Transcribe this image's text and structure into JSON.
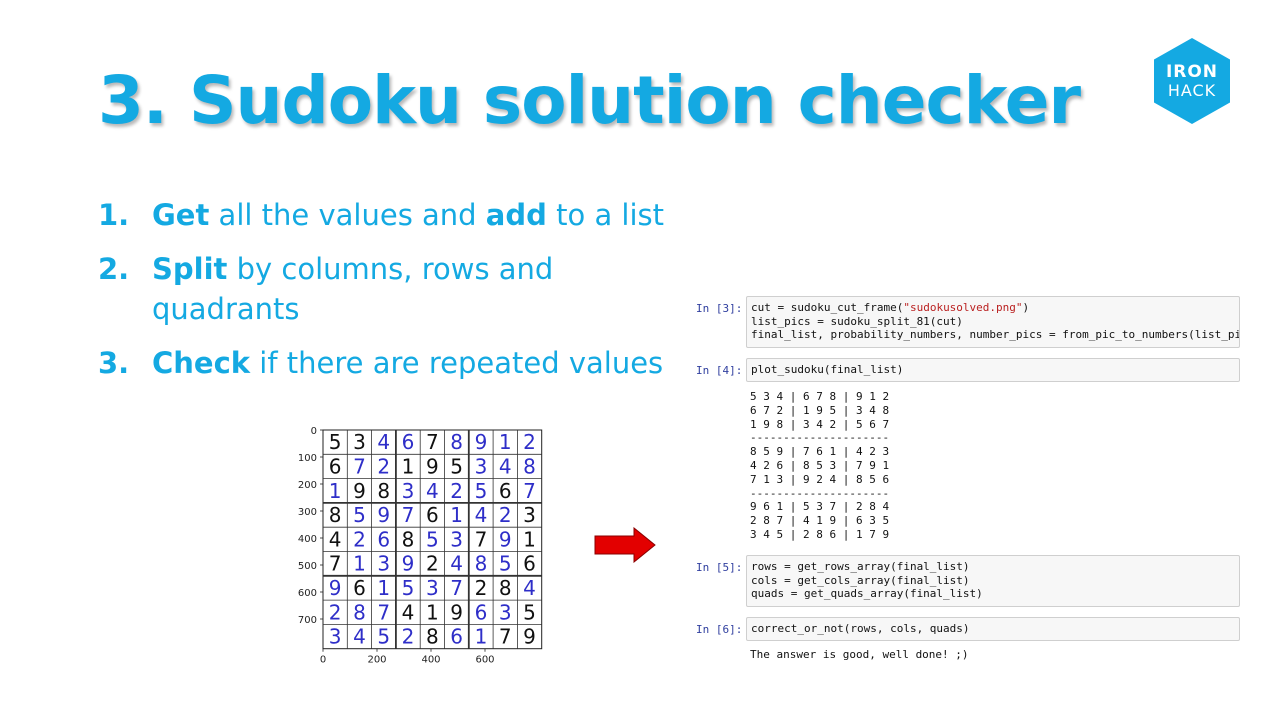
{
  "title": "3. Sudoku solution checker",
  "logo": {
    "line1": "IRON",
    "line2": "HACK",
    "color": "#14a9e2"
  },
  "steps": [
    {
      "num": "1.",
      "parts": [
        {
          "t": "Get",
          "b": true
        },
        {
          "t": " all the values and ",
          "b": false
        },
        {
          "t": "add",
          "b": true
        },
        {
          "t": " to a list",
          "b": false
        }
      ]
    },
    {
      "num": "2.",
      "parts": [
        {
          "t": "Split",
          "b": true
        },
        {
          "t": " by columns, rows and quadrants",
          "b": false
        }
      ]
    },
    {
      "num": "3.",
      "parts": [
        {
          "t": "Check",
          "b": true
        },
        {
          "t": " if there are repeated values",
          "b": false
        }
      ]
    }
  ],
  "sudoku_plot": {
    "grid": [
      [
        "5",
        "3",
        "4",
        "6",
        "7",
        "8",
        "9",
        "1",
        "2"
      ],
      [
        "6",
        "7",
        "2",
        "1",
        "9",
        "5",
        "3",
        "4",
        "8"
      ],
      [
        "1",
        "9",
        "8",
        "3",
        "4",
        "2",
        "5",
        "6",
        "7"
      ],
      [
        "8",
        "5",
        "9",
        "7",
        "6",
        "1",
        "4",
        "2",
        "3"
      ],
      [
        "4",
        "2",
        "6",
        "8",
        "5",
        "3",
        "7",
        "9",
        "1"
      ],
      [
        "7",
        "1",
        "3",
        "9",
        "2",
        "4",
        "8",
        "5",
        "6"
      ],
      [
        "9",
        "6",
        "1",
        "5",
        "3",
        "7",
        "2",
        "8",
        "4"
      ],
      [
        "2",
        "8",
        "7",
        "4",
        "1",
        "9",
        "6",
        "3",
        "5"
      ],
      [
        "3",
        "4",
        "5",
        "2",
        "8",
        "6",
        "1",
        "7",
        "9"
      ]
    ],
    "blue_cells": [
      [
        0,
        2
      ],
      [
        0,
        3
      ],
      [
        0,
        5
      ],
      [
        0,
        6
      ],
      [
        0,
        7
      ],
      [
        0,
        8
      ],
      [
        1,
        1
      ],
      [
        1,
        2
      ],
      [
        1,
        6
      ],
      [
        1,
        7
      ],
      [
        1,
        8
      ],
      [
        2,
        0
      ],
      [
        2,
        3
      ],
      [
        2,
        4
      ],
      [
        2,
        5
      ],
      [
        2,
        6
      ],
      [
        2,
        8
      ],
      [
        3,
        1
      ],
      [
        3,
        2
      ],
      [
        3,
        3
      ],
      [
        3,
        5
      ],
      [
        3,
        6
      ],
      [
        3,
        7
      ],
      [
        4,
        1
      ],
      [
        4,
        2
      ],
      [
        4,
        4
      ],
      [
        4,
        5
      ],
      [
        4,
        7
      ],
      [
        5,
        1
      ],
      [
        5,
        2
      ],
      [
        5,
        3
      ],
      [
        5,
        5
      ],
      [
        5,
        6
      ],
      [
        5,
        7
      ],
      [
        6,
        0
      ],
      [
        6,
        2
      ],
      [
        6,
        3
      ],
      [
        6,
        4
      ],
      [
        6,
        5
      ],
      [
        6,
        8
      ],
      [
        7,
        0
      ],
      [
        7,
        1
      ],
      [
        7,
        2
      ],
      [
        7,
        6
      ],
      [
        7,
        7
      ],
      [
        8,
        0
      ],
      [
        8,
        1
      ],
      [
        8,
        2
      ],
      [
        8,
        3
      ],
      [
        8,
        5
      ],
      [
        8,
        6
      ]
    ],
    "y_ticks": [
      "0",
      "100",
      "200",
      "300",
      "400",
      "500",
      "600",
      "700"
    ],
    "x_ticks": [
      "0",
      "200",
      "400",
      "600"
    ],
    "digit_color_black": "#111111",
    "digit_color_blue": "#2e2ec8"
  },
  "arrow_color": "#e30000",
  "notebook": {
    "cells": [
      {
        "prompt": "In [3]:",
        "code": [
          [
            {
              "t": "cut = sudoku_cut_frame("
            },
            {
              "t": "\"sudokusolved.png\"",
              "s": true
            },
            {
              "t": ")"
            }
          ],
          [
            {
              "t": "list_pics = sudoku_split_81(cut)"
            }
          ],
          [
            {
              "t": "final_list, probability_numbers, number_pics = from_pic_to_numbers(list_pics)"
            }
          ]
        ],
        "output": []
      },
      {
        "prompt": "In [4]:",
        "code": [
          [
            {
              "t": "plot_sudoku(final_list)"
            }
          ]
        ],
        "output": [
          "5 3 4 | 6 7 8 | 9 1 2",
          "6 7 2 | 1 9 5 | 3 4 8",
          "1 9 8 | 3 4 2 | 5 6 7",
          "---------------------",
          "8 5 9 | 7 6 1 | 4 2 3",
          "4 2 6 | 8 5 3 | 7 9 1",
          "7 1 3 | 9 2 4 | 8 5 6",
          "---------------------",
          "9 6 1 | 5 3 7 | 2 8 4",
          "2 8 7 | 4 1 9 | 6 3 5",
          "3 4 5 | 2 8 6 | 1 7 9"
        ]
      },
      {
        "prompt": "In [5]:",
        "code": [
          [
            {
              "t": "rows = get_rows_array(final_list)"
            }
          ],
          [
            {
              "t": "cols = get_cols_array(final_list)"
            }
          ],
          [
            {
              "t": "quads = get_quads_array(final_list)"
            }
          ]
        ],
        "output": []
      },
      {
        "prompt": "In [6]:",
        "code": [
          [
            {
              "t": "correct_or_not(rows, cols, quads)"
            }
          ]
        ],
        "output": [
          "The answer is good, well done! ;)"
        ]
      }
    ]
  }
}
